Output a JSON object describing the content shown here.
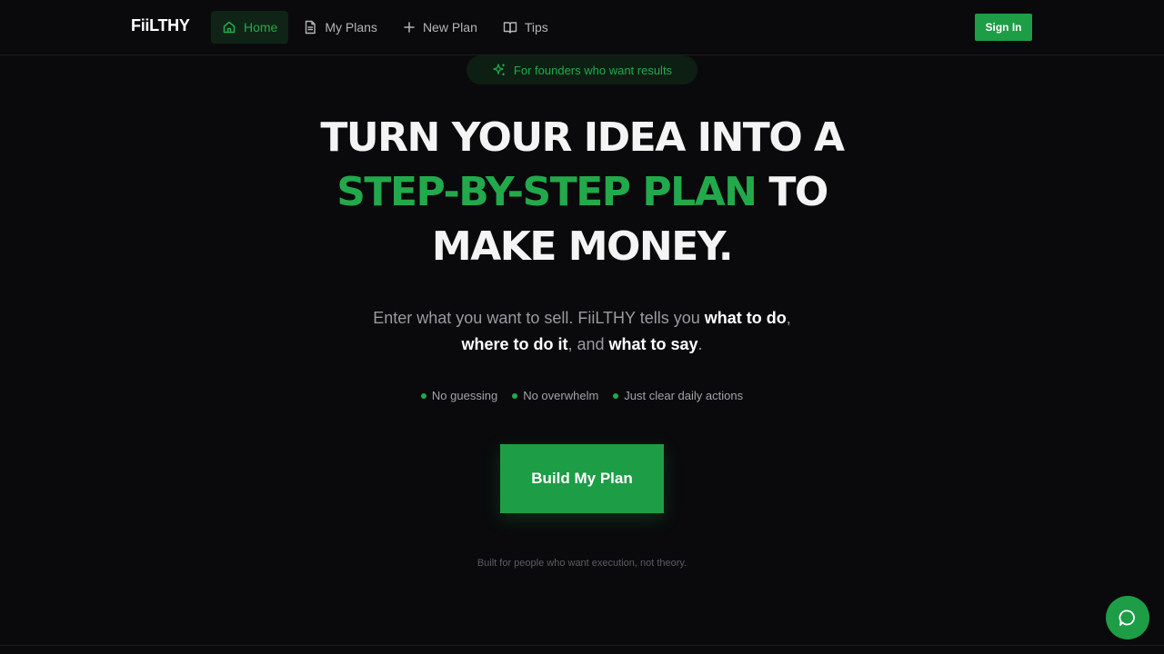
{
  "header": {
    "brand": "FiiLTHY",
    "nav": [
      {
        "label": "Home",
        "icon": "home-icon",
        "active": true
      },
      {
        "label": "My Plans",
        "icon": "document-icon",
        "active": false
      },
      {
        "label": "New Plan",
        "icon": "plus-icon",
        "active": false
      },
      {
        "label": "Tips",
        "icon": "book-icon",
        "active": false
      }
    ],
    "sign_in_label": "Sign In"
  },
  "hero": {
    "badge": "For founders who want results",
    "headline_part1": "TURN YOUR IDEA INTO A",
    "headline_accent": "STEP-BY-STEP PLAN",
    "headline_part2": " TO",
    "headline_part3": "MAKE MONEY.",
    "subtitle": {
      "intro": "Enter what you want to sell. FiiLTHY tells you ",
      "bold1": "what to do",
      "sep1": ",",
      "bold2": "where to do it",
      "sep2": ", and ",
      "bold3": "what to say",
      "end": "."
    },
    "bullets": [
      "No guessing",
      "No overwhelm",
      "Just clear daily actions"
    ],
    "cta_label": "Build My Plan",
    "footnote": "Built for people who want execution, not theory."
  },
  "chat": {
    "icon": "chat-bubble-icon"
  },
  "colors": {
    "background": "#0a0a0c",
    "accent": "#22a94b",
    "button": "#1d9d45"
  }
}
